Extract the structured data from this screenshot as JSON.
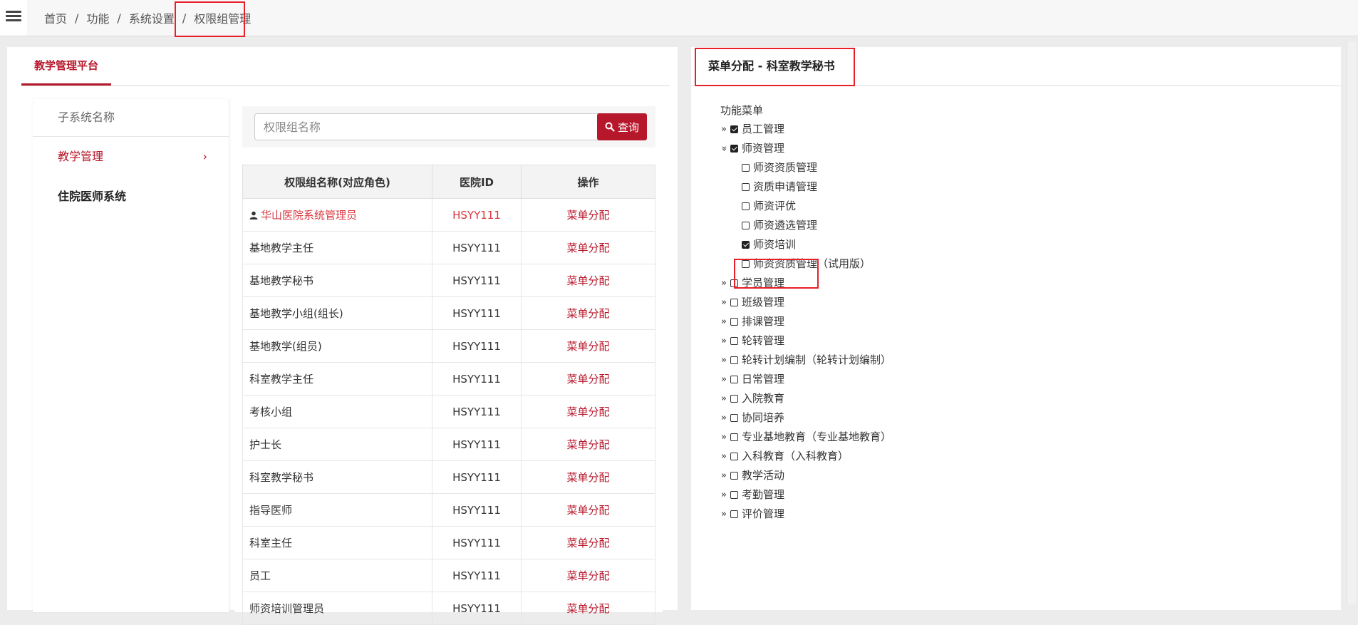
{
  "breadcrumb": [
    {
      "label": "首页"
    },
    {
      "label": "功能"
    },
    {
      "label": "系统设置"
    },
    {
      "label": "权限组管理"
    }
  ],
  "breadcrumb_sep": "/",
  "left": {
    "tab_label": "教学管理平台",
    "subsystem_header": "子系统名称",
    "subsystems": [
      {
        "label": "教学管理",
        "active": true
      },
      {
        "label": "住院医师系统",
        "active": false
      }
    ],
    "chevron": "›",
    "search": {
      "placeholder": "权限组名称",
      "button_label": "查询",
      "button_icon": "search-icon"
    },
    "table": {
      "headers": [
        "权限组名称(对应角色)",
        "医院ID",
        "操作"
      ],
      "rows": [
        {
          "name": "华山医院系统管理员",
          "id": "HSYY111",
          "op": "菜单分配",
          "highlight": true
        },
        {
          "name": "基地教学主任",
          "id": "HSYY111",
          "op": "菜单分配"
        },
        {
          "name": "基地教学秘书",
          "id": "HSYY111",
          "op": "菜单分配"
        },
        {
          "name": "基地教学小组(组长)",
          "id": "HSYY111",
          "op": "菜单分配"
        },
        {
          "name": "基地教学(组员)",
          "id": "HSYY111",
          "op": "菜单分配"
        },
        {
          "name": "科室教学主任",
          "id": "HSYY111",
          "op": "菜单分配"
        },
        {
          "name": "考核小组",
          "id": "HSYY111",
          "op": "菜单分配"
        },
        {
          "name": "护士长",
          "id": "HSYY111",
          "op": "菜单分配"
        },
        {
          "name": "科室教学秘书",
          "id": "HSYY111",
          "op": "菜单分配"
        },
        {
          "name": "指导医师",
          "id": "HSYY111",
          "op": "菜单分配"
        },
        {
          "name": "科室主任",
          "id": "HSYY111",
          "op": "菜单分配"
        },
        {
          "name": "员工",
          "id": "HSYY111",
          "op": "菜单分配"
        },
        {
          "name": "师资培训管理员",
          "id": "HSYY111",
          "op": "菜单分配"
        }
      ]
    }
  },
  "right": {
    "title": "菜单分配 - 科室教学秘书",
    "tree_root": "功能菜单",
    "items": [
      {
        "label": "员工管理",
        "checked": true,
        "expander": "»"
      },
      {
        "label": "师资管理",
        "checked": true,
        "expander": "»",
        "expanded": true,
        "children": [
          {
            "label": "师资资质管理",
            "checked": false
          },
          {
            "label": "资质申请管理",
            "checked": false
          },
          {
            "label": "师资评优",
            "checked": false
          },
          {
            "label": "师资遴选管理",
            "checked": false
          },
          {
            "label": "师资培训",
            "checked": true
          },
          {
            "label": "师资资质管理（试用版）",
            "checked": false
          }
        ]
      },
      {
        "label": "学员管理",
        "checked": false,
        "expander": "»"
      },
      {
        "label": "班级管理",
        "checked": false,
        "expander": "»"
      },
      {
        "label": "排课管理",
        "checked": false,
        "expander": "»"
      },
      {
        "label": "轮转管理",
        "checked": false,
        "expander": "»"
      },
      {
        "label": "轮转计划编制（轮转计划编制）",
        "checked": false,
        "expander": "»"
      },
      {
        "label": "日常管理",
        "checked": false,
        "expander": "»"
      },
      {
        "label": "入院教育",
        "checked": false,
        "expander": "»"
      },
      {
        "label": "协同培养",
        "checked": false,
        "expander": "»"
      },
      {
        "label": "专业基地教育（专业基地教育）",
        "checked": false,
        "expander": "»"
      },
      {
        "label": "入科教育（入科教育）",
        "checked": false,
        "expander": "»"
      },
      {
        "label": "教学活动",
        "checked": false,
        "expander": "»"
      },
      {
        "label": "考勤管理",
        "checked": false,
        "expander": "»"
      },
      {
        "label": "评价管理",
        "checked": false,
        "expander": "»"
      }
    ]
  },
  "colors": {
    "accent": "#b6172a",
    "link_red": "#d9363e",
    "annotation_red": "#e8202a"
  }
}
